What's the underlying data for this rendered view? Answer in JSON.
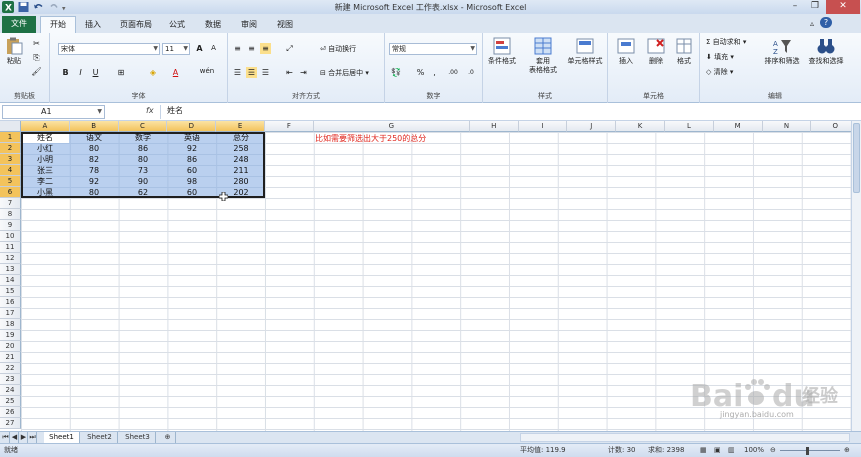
{
  "window": {
    "title": "新建 Microsoft Excel 工作表.xlsx - Microsoft Excel"
  },
  "tabs": [
    "文件",
    "开始",
    "插入",
    "页面布局",
    "公式",
    "数据",
    "审阅",
    "视图"
  ],
  "ribbon": {
    "clipboard": {
      "label": "剪贴板",
      "paste": "粘贴"
    },
    "font": {
      "label": "字体",
      "name": "宋体",
      "size": "11",
      "bold": "B",
      "italic": "I",
      "underline": "U",
      "size_up": "A",
      "size_down": "A",
      "color_letter": "A",
      "phonetic": "wén"
    },
    "alignment": {
      "label": "对齐方式",
      "wrap": "自动换行",
      "merge": "合并后居中"
    },
    "number": {
      "label": "数字",
      "format": "常规",
      "percent": "%",
      "comma": ",",
      "inc_dec": ".00",
      "dec_dec": ".0"
    },
    "styles": {
      "label": "样式",
      "conditional": "条件格式",
      "as_table": "套用",
      "as_table2": "表格格式",
      "cell_styles": "单元格样式"
    },
    "cells": {
      "label": "单元格",
      "insert": "插入",
      "delete": "删除",
      "format": "格式"
    },
    "editing": {
      "label": "编辑",
      "autosum": "自动求和",
      "fill": "填充",
      "clear": "清除",
      "sort": "排序和筛选",
      "find": "查找和选择"
    }
  },
  "formula_bar": {
    "name_box": "A1",
    "fx": "fx",
    "content": "姓名"
  },
  "columns": [
    "A",
    "B",
    "C",
    "D",
    "E",
    "F",
    "G",
    "H",
    "I",
    "J",
    "K",
    "L",
    "M",
    "N",
    "O"
  ],
  "rows": [
    "1",
    "2",
    "3",
    "4",
    "5",
    "6",
    "7",
    "8",
    "9",
    "10",
    "11",
    "12",
    "13",
    "14",
    "15",
    "16",
    "17",
    "18",
    "19",
    "20",
    "21",
    "22",
    "23",
    "24",
    "25",
    "26",
    "27"
  ],
  "table": {
    "header": [
      "姓名",
      "语文",
      "数学",
      "英语",
      "总分"
    ],
    "rows": [
      [
        "小红",
        "80",
        "86",
        "92",
        "258"
      ],
      [
        "小明",
        "82",
        "80",
        "86",
        "248"
      ],
      [
        "张三",
        "78",
        "73",
        "60",
        "211"
      ],
      [
        "李二",
        "92",
        "90",
        "98",
        "280"
      ],
      [
        "小黑",
        "80",
        "62",
        "60",
        "202"
      ]
    ]
  },
  "note": "比如需要筛选出大于250的总分",
  "sheet_tabs": [
    "Sheet1",
    "Sheet2",
    "Sheet3"
  ],
  "status": {
    "ready": "就绪",
    "average": "平均值: 119.9",
    "count": "计数: 30",
    "sum": "求和: 2398",
    "zoom": "100%"
  },
  "watermark": {
    "brand": "Baidu",
    "sub": "经验",
    "url": "jingyan.baidu.com"
  },
  "colors": {
    "file_tab": "#1e7145",
    "selection": "#82aae1",
    "note": "#e0261d",
    "header_sel": "#f3c35c"
  }
}
